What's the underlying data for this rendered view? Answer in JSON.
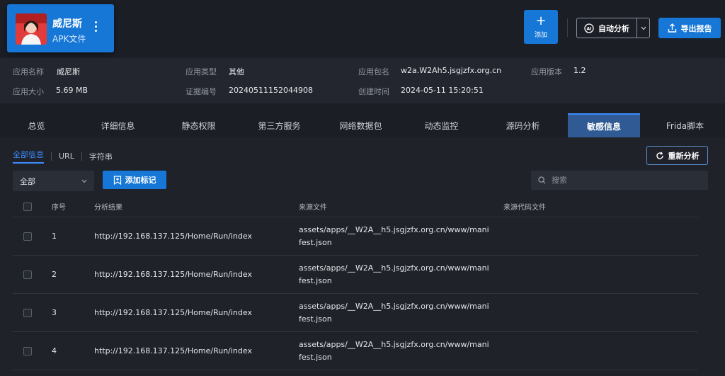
{
  "app": {
    "name": "威尼斯",
    "type": "APK文件"
  },
  "toolbar": {
    "add_label": "添加",
    "auto_label": "自动分析",
    "export_label": "导出报告"
  },
  "info": {
    "name_key": "应用名称",
    "name_val": "威尼斯",
    "apptype_key": "应用类型",
    "apptype_val": "其他",
    "package_key": "应用包名",
    "package_val": "w2a.W2Ah5.jsgjzfx.org.cn",
    "version_key": "应用版本",
    "version_val": "1.2",
    "size_key": "应用大小",
    "size_val": "5.69 MB",
    "cert_key": "证据编号",
    "cert_val": "20240511152044908",
    "created_key": "创建时间",
    "created_val": "2024-05-11 15:20:51"
  },
  "tabs": [
    "总览",
    "详细信息",
    "静态权限",
    "第三方服务",
    "网络数据包",
    "动态监控",
    "源码分析",
    "敏感信息",
    "Frida脚本"
  ],
  "active_tab": 7,
  "subtabs": [
    "全部信息",
    "URL",
    "字符串"
  ],
  "rerun_label": "重新分析",
  "filter": {
    "selected": "全部"
  },
  "tag_label": "添加标记",
  "search": {
    "placeholder": "搜索",
    "value": ""
  },
  "table": {
    "headers": {
      "index": "序号",
      "result": "分析结果",
      "source": "来源文件",
      "code": "来源代码文件"
    },
    "rows": [
      {
        "index": "1",
        "result": "http://192.168.137.125/Home/Run/index",
        "source": "assets/apps/__W2A__h5.jsgjzfx.org.cn/www/manifest.json",
        "code": ""
      },
      {
        "index": "2",
        "result": "http://192.168.137.125/Home/Run/index",
        "source": "assets/apps/__W2A__h5.jsgjzfx.org.cn/www/manifest.json",
        "code": ""
      },
      {
        "index": "3",
        "result": "http://192.168.137.125/Home/Run/index",
        "source": "assets/apps/__W2A__h5.jsgjzfx.org.cn/www/manifest.json",
        "code": ""
      },
      {
        "index": "4",
        "result": "http://192.168.137.125/Home/Run/index",
        "source": "assets/apps/__W2A__h5.jsgjzfx.org.cn/www/manifest.json",
        "code": ""
      }
    ]
  },
  "colors": {
    "accent": "#1677d6",
    "active_tab": "#2f5a93",
    "background": "#1b1e25"
  }
}
